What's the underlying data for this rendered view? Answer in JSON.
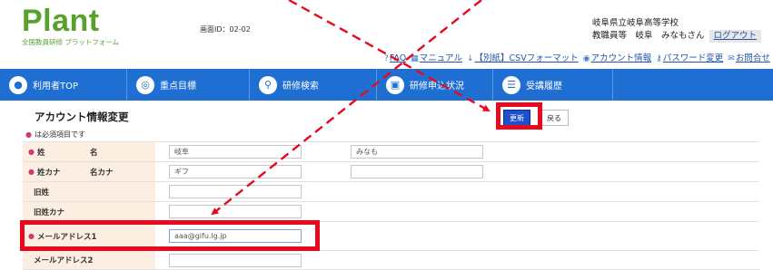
{
  "header": {
    "logo_text": "Plant",
    "logo_subtitle": "全国教員研修 プラットフォーム",
    "screen_id": "画面ID：02-02",
    "school": "岐阜県立岐阜高等学校",
    "user": "教職員等　岐阜　みなもさん",
    "logout_label": "ログアウト"
  },
  "utility_links": [
    {
      "icon": "question-icon",
      "glyph": "?",
      "label": "FAQ"
    },
    {
      "icon": "book-icon",
      "glyph": "▦",
      "label": "マニュアル"
    },
    {
      "icon": "download-icon",
      "glyph": "↓",
      "label": "【別紙】CSVフォーマット"
    },
    {
      "icon": "account-icon",
      "glyph": "◉",
      "label": "アカウント情報"
    },
    {
      "icon": "key-icon",
      "glyph": "⚷",
      "label": "パスワード変更"
    },
    {
      "icon": "mail-icon",
      "glyph": "✉",
      "label": "お問合せ"
    }
  ],
  "nav": [
    {
      "icon": "user-icon",
      "glyph": "●",
      "label": "利用者TOP"
    },
    {
      "icon": "target-icon",
      "glyph": "◎",
      "label": "重点目標"
    },
    {
      "icon": "search-icon",
      "glyph": "⚲",
      "label": "研修検索"
    },
    {
      "icon": "status-icon",
      "glyph": "▣",
      "label": "研修申込状況"
    },
    {
      "icon": "history-icon",
      "glyph": "☰",
      "label": "受講履歴"
    }
  ],
  "page": {
    "title": "アカウント情報変更",
    "update_button": "更新",
    "back_button": "戻る",
    "required_note": "は必須項目です",
    "required_mark": "●"
  },
  "form": {
    "name_row": {
      "label1": "姓",
      "label2": "名",
      "value1": "岐阜",
      "value2": "みなも"
    },
    "kana_row": {
      "label1": "姓カナ",
      "label2": "名カナ",
      "value1": "ギフ",
      "value2": ""
    },
    "old_surname": {
      "label": "旧姓",
      "value": ""
    },
    "old_surname_kana": {
      "label": "旧姓カナ",
      "value": ""
    },
    "email1": {
      "label": "メールアドレス1",
      "value": "aaa@gifu.lg.jp"
    },
    "email2": {
      "label": "メールアドレス2",
      "value": ""
    }
  },
  "colors": {
    "nav_bg": "#1f6fd3",
    "logo_green": "#5aa02c",
    "label_bg": "#fdeee2",
    "required_pink": "#d23a6b",
    "highlight_red": "#e8091d",
    "update_btn": "#1d4fcf"
  }
}
